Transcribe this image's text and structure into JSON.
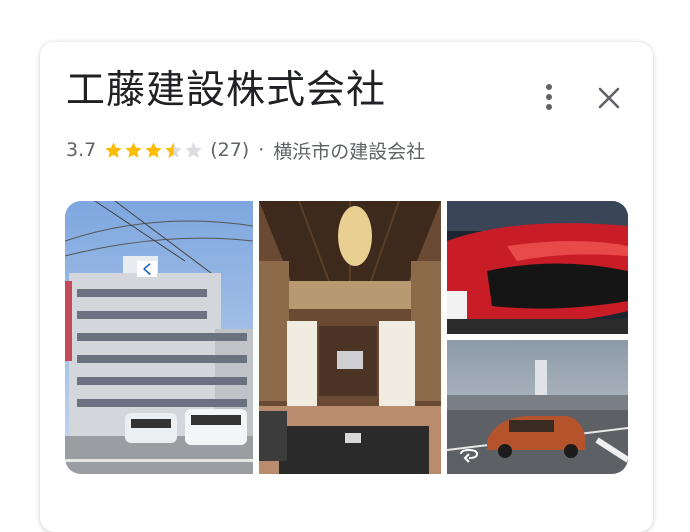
{
  "place": {
    "name": "工藤建設株式会社",
    "rating": "3.7",
    "stars_value": 3.7,
    "stars_max": 5,
    "review_count": "(27)",
    "separator": "·",
    "category": "横浜市の建設会社"
  },
  "icons": {
    "more": "more-vert-icon",
    "close": "close-icon",
    "street_view": "street-view-360-icon"
  },
  "colors": {
    "star_filled": "#FBBC04",
    "star_empty": "#DADCE0",
    "title": "#202124",
    "meta": "#5F6368"
  },
  "photos": {
    "building_sign": "く"
  }
}
